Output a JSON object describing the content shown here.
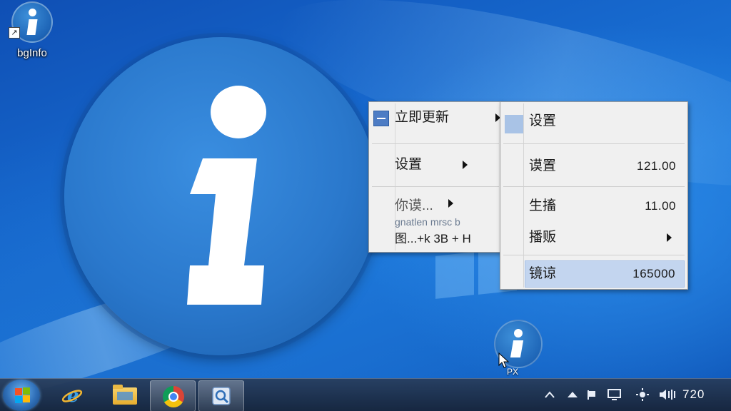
{
  "desktop": {
    "icon_label": "bgInfo",
    "icon_name": "bginfo-icon",
    "small_icon_label": "PX"
  },
  "menu1": {
    "items": [
      {
        "label": "立即更新",
        "has_submenu": true,
        "icon": "checkbox-icon"
      },
      {
        "label": "设置",
        "has_submenu": true
      },
      {
        "label": "你谟...",
        "has_submenu": true
      },
      {
        "label": "gnatlen mrsc b"
      },
      {
        "label": "图...+k 3B  + H"
      }
    ]
  },
  "menu2": {
    "items": [
      {
        "label": "设置",
        "value": "",
        "icon": "swatch-icon"
      },
      {
        "label": "谟置",
        "value": "121.00"
      },
      {
        "label": "生搐",
        "value": "11.00"
      },
      {
        "label": "播贩",
        "value": "",
        "has_submenu": true
      },
      {
        "label": "镜谅",
        "value": "165000",
        "highlighted": true
      }
    ]
  },
  "taskbar": {
    "pinned": [
      {
        "name": "internet-explorer-icon"
      },
      {
        "name": "file-explorer-icon"
      },
      {
        "name": "chrome-icon"
      },
      {
        "name": "tool-icon"
      }
    ],
    "tray": {
      "icons": [
        "chevron-up-icon",
        "network-icon",
        "flag-icon",
        "monitor-icon",
        "brightness-icon",
        "volume-icon"
      ],
      "clock": "720"
    }
  },
  "colors": {
    "menu_bg": "#f0f0f0",
    "highlight": "#c3d5ef",
    "accent": "#1d64b6"
  }
}
